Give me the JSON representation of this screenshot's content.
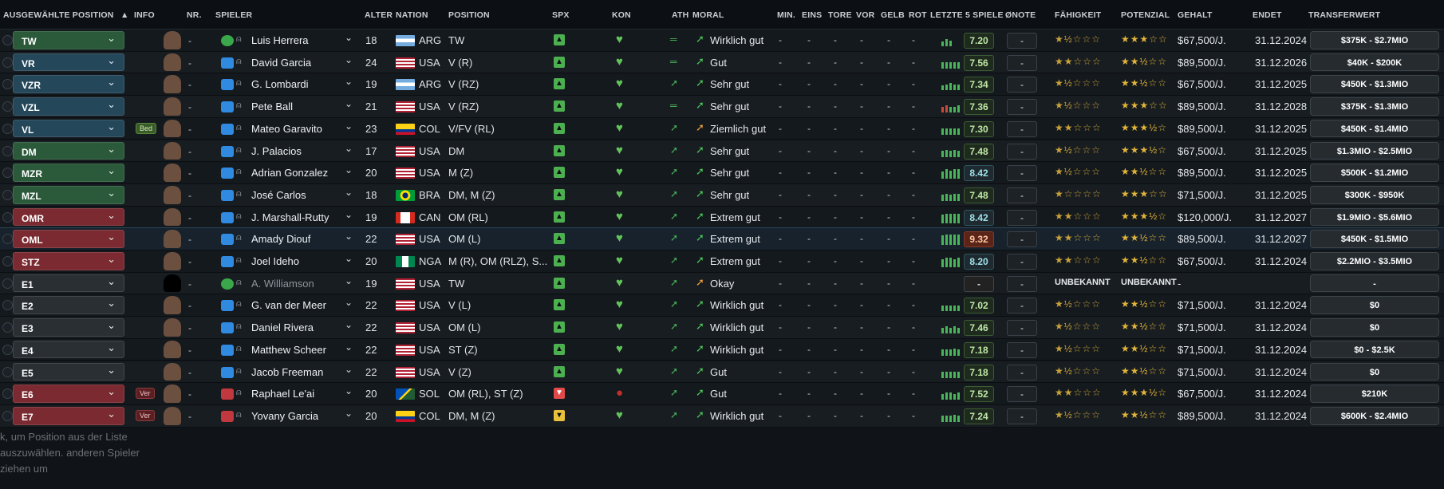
{
  "header": {
    "col_position": "AUSGEWÄHLTE POSITION",
    "col_info": "INFO",
    "col_nr": "NR.",
    "col_spieler": "SPIELER",
    "col_alter": "ALTER",
    "col_nation": "NATION",
    "col_pos": "POSITION",
    "col_spx": "SPX",
    "col_kon": "KON",
    "col_ath": "ATH",
    "col_moral": "MORAL",
    "col_min": "MIN.",
    "col_eins": "EINS",
    "col_tore": "TORE",
    "col_vor": "VOR",
    "col_gelb": "GELB",
    "col_rot": "ROT",
    "col_letzte": "LETZTE 5 SPIELE",
    "col_onote": "ØNOTE",
    "col_faehigkeit": "FÄHIGKEIT",
    "col_potenzial": "POTENZIAL",
    "col_gehalt": "GEHALT",
    "col_endet": "ENDET",
    "col_transfer": "TRANSFERWERT"
  },
  "colors": {
    "green_pos": "#2a5a3a",
    "blue_pos": "#24475a",
    "red_pos": "#7a2a30",
    "neutral_pos": "#2a2f34",
    "accent_green": "#4ab55a"
  },
  "rows": [
    {
      "pos": "TW",
      "pos_color": "g",
      "info": "",
      "nr": "-",
      "name": "Luis Herrera",
      "shirt": "green",
      "alter": "18",
      "nation": "ARG",
      "position": "TW",
      "spx": "g",
      "moral": "Wirklich gut",
      "stats": [
        "-",
        "-",
        "-",
        "-",
        "-",
        "-"
      ],
      "note": "7.20",
      "note_style": "",
      "onote": "-",
      "faeh": "★½☆☆☆",
      "pot": "★★★☆☆",
      "gehalt": "$67,500/J.",
      "endet": "31.12.2024",
      "tw": "$375K - $2.7MIO",
      "bars": [
        4,
        6,
        5
      ],
      "flag": "arg"
    },
    {
      "pos": "VR",
      "pos_color": "b",
      "info": "",
      "nr": "-",
      "name": "David Garcia",
      "shirt": "blue",
      "alter": "24",
      "nation": "USA",
      "position": "V (R)",
      "spx": "g",
      "moral": "Gut",
      "stats": [
        "-",
        "-",
        "-",
        "-",
        "-",
        "-"
      ],
      "note": "7.56",
      "note_style": "",
      "onote": "-",
      "faeh": "★★☆☆☆",
      "pot": "★★½☆☆",
      "gehalt": "$89,500/J.",
      "endet": "31.12.2026",
      "tw": "$40K - $200K",
      "bars": [
        5,
        5,
        5,
        5,
        5
      ],
      "flag": "usa"
    },
    {
      "pos": "VZR",
      "pos_color": "b",
      "info": "",
      "nr": "-",
      "name": "G. Lombardi",
      "shirt": "blue",
      "alter": "19",
      "nation": "ARG",
      "position": "V (RZ)",
      "spx": "g",
      "moral": "Sehr gut",
      "stats": [
        "-",
        "-",
        "-",
        "-",
        "-",
        "-"
      ],
      "note": "7.34",
      "note_style": "",
      "onote": "-",
      "faeh": "★½☆☆☆",
      "pot": "★★½☆☆",
      "gehalt": "$67,500/J.",
      "endet": "31.12.2025",
      "tw": "$450K - $1.3MIO",
      "bars": [
        4,
        5,
        6,
        5,
        5
      ],
      "flag": "arg"
    },
    {
      "pos": "VZL",
      "pos_color": "b",
      "info": "",
      "nr": "-",
      "name": "Pete Ball",
      "shirt": "blue",
      "alter": "21",
      "nation": "USA",
      "position": "V (RZ)",
      "spx": "g",
      "moral": "Sehr gut",
      "stats": [
        "-",
        "-",
        "-",
        "-",
        "-",
        "-"
      ],
      "note": "7.36",
      "note_style": "",
      "onote": "-",
      "faeh": "★½☆☆☆",
      "pot": "★★★☆☆",
      "gehalt": "$89,500/J.",
      "endet": "31.12.2028",
      "tw": "$375K - $1.3MIO",
      "bars": [
        5,
        6,
        5,
        5,
        6
      ],
      "flag": "usa"
    },
    {
      "pos": "VL",
      "pos_color": "b",
      "info": "Bed",
      "nr": "-",
      "name": "Mateo Garavito",
      "shirt": "blue",
      "alter": "23",
      "nation": "COL",
      "position": "V/FV (RL)",
      "spx": "g",
      "moral": "Ziemlich gut",
      "stats": [
        "-",
        "-",
        "-",
        "-",
        "-",
        "-"
      ],
      "note": "7.30",
      "note_style": "",
      "onote": "-",
      "faeh": "★★☆☆☆",
      "pot": "★★★½☆",
      "gehalt": "$89,500/J.",
      "endet": "31.12.2025",
      "tw": "$450K - $1.4MIO",
      "bars": [
        5,
        5,
        5,
        5,
        5
      ],
      "flag": "col"
    },
    {
      "pos": "DM",
      "pos_color": "g",
      "info": "",
      "nr": "-",
      "name": "J. Palacios",
      "shirt": "blue",
      "alter": "17",
      "nation": "USA",
      "position": "DM",
      "spx": "g",
      "moral": "Sehr gut",
      "stats": [
        "-",
        "-",
        "-",
        "-",
        "-",
        "-"
      ],
      "note": "7.48",
      "note_style": "",
      "onote": "-",
      "faeh": "★½☆☆☆",
      "pot": "★★★½☆",
      "gehalt": "$67,500/J.",
      "endet": "31.12.2025",
      "tw": "$1.3MIO - $2.5MIO",
      "bars": [
        5,
        6,
        5,
        6,
        5
      ],
      "flag": "usa"
    },
    {
      "pos": "MZR",
      "pos_color": "g",
      "info": "",
      "nr": "-",
      "name": "Adrian Gonzalez",
      "shirt": "blue",
      "alter": "20",
      "nation": "USA",
      "position": "M (Z)",
      "spx": "g",
      "moral": "Sehr gut",
      "stats": [
        "-",
        "-",
        "-",
        "-",
        "-",
        "-"
      ],
      "note": "8.42",
      "note_style": "t",
      "onote": "-",
      "faeh": "★½☆☆☆",
      "pot": "★★½☆☆",
      "gehalt": "$89,500/J.",
      "endet": "31.12.2025",
      "tw": "$500K - $1.2MIO",
      "bars": [
        6,
        8,
        7,
        8,
        8
      ],
      "flag": "usa"
    },
    {
      "pos": "MZL",
      "pos_color": "g",
      "info": "",
      "nr": "-",
      "name": "José Carlos",
      "shirt": "blue",
      "alter": "18",
      "nation": "BRA",
      "position": "DM, M (Z)",
      "spx": "g",
      "moral": "Sehr gut",
      "stats": [
        "-",
        "-",
        "-",
        "-",
        "-",
        "-"
      ],
      "note": "7.48",
      "note_style": "",
      "onote": "-",
      "faeh": "★☆☆☆☆",
      "pot": "★★★☆☆",
      "gehalt": "$71,500/J.",
      "endet": "31.12.2025",
      "tw": "$300K - $950K",
      "bars": [
        5,
        6,
        5,
        6,
        6
      ],
      "flag": "bra"
    },
    {
      "pos": "OMR",
      "pos_color": "r",
      "info": "",
      "nr": "-",
      "name": "J. Marshall-Rutty",
      "shirt": "blue",
      "alter": "19",
      "nation": "CAN",
      "position": "OM (RL)",
      "spx": "g",
      "moral": "Extrem gut",
      "stats": [
        "-",
        "-",
        "-",
        "-",
        "-",
        "-"
      ],
      "note": "8.42",
      "note_style": "t",
      "onote": "-",
      "faeh": "★★☆☆☆",
      "pot": "★★★½☆",
      "gehalt": "$120,000/J.",
      "endet": "31.12.2027",
      "tw": "$1.9MIO - $5.6MIO",
      "bars": [
        7,
        8,
        8,
        8,
        8
      ],
      "flag": "can"
    },
    {
      "pos": "OML",
      "pos_color": "r",
      "info": "",
      "nr": "-",
      "name": "Amady Diouf",
      "shirt": "blue",
      "alter": "22",
      "nation": "USA",
      "position": "OM (L)",
      "spx": "g",
      "moral": "Extrem gut",
      "stats": [
        "-",
        "-",
        "-",
        "-",
        "-",
        "-"
      ],
      "note": "9.32",
      "note_style": "hi",
      "onote": "-",
      "faeh": "★★☆☆☆",
      "pot": "★★½☆☆",
      "gehalt": "$89,500/J.",
      "endet": "31.12.2027",
      "tw": "$450K - $1.5MIO",
      "bars": [
        8,
        9,
        9,
        9,
        9
      ],
      "flag": "usa",
      "selected": true
    },
    {
      "pos": "STZ",
      "pos_color": "r",
      "info": "",
      "nr": "-",
      "name": "Joel Ideho",
      "shirt": "blue",
      "alter": "20",
      "nation": "NGA",
      "position": "M (R), OM (RLZ), S...",
      "spx": "g",
      "moral": "Extrem gut",
      "stats": [
        "-",
        "-",
        "-",
        "-",
        "-",
        "-"
      ],
      "note": "8.20",
      "note_style": "t",
      "onote": "-",
      "faeh": "★★☆☆☆",
      "pot": "★★½☆☆",
      "gehalt": "$67,500/J.",
      "endet": "31.12.2024",
      "tw": "$2.2MIO - $3.5MIO",
      "bars": [
        7,
        8,
        8,
        7,
        8
      ],
      "flag": "nga"
    },
    {
      "pos": "E1",
      "pos_color": "n",
      "info": "",
      "nr": "-",
      "name": "A. Williamson",
      "shirt": "green",
      "dim": true,
      "alter": "19",
      "nation": "USA",
      "position": "TW",
      "spx": "g",
      "moral": "Okay",
      "stats": [
        "-",
        "-",
        "-",
        "-",
        "-",
        "-"
      ],
      "note": "-",
      "note_style": "e",
      "onote": "-",
      "faeh": "UNBEKANNT",
      "pot": "UNBEKANNT",
      "gehalt": "-",
      "endet": "",
      "tw": "-",
      "bars": [],
      "flag": "usa",
      "blankface": true
    },
    {
      "pos": "E2",
      "pos_color": "n",
      "info": "",
      "nr": "-",
      "name": "G. van der Meer",
      "shirt": "blue",
      "alter": "22",
      "nation": "USA",
      "position": "V (L)",
      "spx": "g",
      "moral": "Wirklich gut",
      "stats": [
        "-",
        "-",
        "-",
        "-",
        "-",
        "-"
      ],
      "note": "7.02",
      "note_style": "",
      "onote": "-",
      "faeh": "★½☆☆☆",
      "pot": "★★½☆☆",
      "gehalt": "$71,500/J.",
      "endet": "31.12.2024",
      "tw": "$0",
      "bars": [
        5,
        5,
        5,
        5,
        5
      ],
      "flag": "usa"
    },
    {
      "pos": "E3",
      "pos_color": "n",
      "info": "",
      "nr": "-",
      "name": "Daniel Rivera",
      "shirt": "blue",
      "alter": "22",
      "nation": "USA",
      "position": "OM (L)",
      "spx": "g",
      "moral": "Wirklich gut",
      "stats": [
        "-",
        "-",
        "-",
        "-",
        "-",
        "-"
      ],
      "note": "7.46",
      "note_style": "",
      "onote": "-",
      "faeh": "★½☆☆☆",
      "pot": "★★½☆☆",
      "gehalt": "$71,500/J.",
      "endet": "31.12.2024",
      "tw": "$0",
      "bars": [
        5,
        6,
        5,
        6,
        5
      ],
      "flag": "usa"
    },
    {
      "pos": "E4",
      "pos_color": "n",
      "info": "",
      "nr": "-",
      "name": "Matthew Scheer",
      "shirt": "blue",
      "alter": "22",
      "nation": "USA",
      "position": "ST (Z)",
      "spx": "g",
      "moral": "Wirklich gut",
      "stats": [
        "-",
        "-",
        "-",
        "-",
        "-",
        "-"
      ],
      "note": "7.18",
      "note_style": "",
      "onote": "-",
      "faeh": "★½☆☆☆",
      "pot": "★★½☆☆",
      "gehalt": "$71,500/J.",
      "endet": "31.12.2024",
      "tw": "$0 - $2.5K",
      "bars": [
        5,
        5,
        5,
        6,
        5
      ],
      "flag": "usa"
    },
    {
      "pos": "E5",
      "pos_color": "n",
      "info": "",
      "nr": "-",
      "name": "Jacob Freeman",
      "shirt": "blue",
      "alter": "22",
      "nation": "USA",
      "position": "V (Z)",
      "spx": "g",
      "moral": "Gut",
      "stats": [
        "-",
        "-",
        "-",
        "-",
        "-",
        "-"
      ],
      "note": "7.18",
      "note_style": "",
      "onote": "-",
      "faeh": "★½☆☆☆",
      "pot": "★★½☆☆",
      "gehalt": "$71,500/J.",
      "endet": "31.12.2024",
      "tw": "$0",
      "bars": [
        5,
        5,
        5,
        5,
        5
      ],
      "flag": "usa"
    },
    {
      "pos": "E6",
      "pos_color": "r",
      "info": "Ver",
      "nr": "-",
      "name": "Raphael Le'ai",
      "shirt": "red",
      "alter": "20",
      "nation": "SOL",
      "position": "OM (RL), ST (Z)",
      "spx": "r",
      "moral": "Gut",
      "stats": [
        "-",
        "-",
        "-",
        "-",
        "-",
        "-"
      ],
      "note": "7.52",
      "note_style": "",
      "onote": "-",
      "faeh": "★★☆☆☆",
      "pot": "★★★½☆",
      "gehalt": "$67,500/J.",
      "endet": "31.12.2024",
      "tw": "$210K",
      "bars": [
        5,
        6,
        6,
        5,
        6
      ],
      "flag": "sol"
    },
    {
      "pos": "E7",
      "pos_color": "r",
      "info": "Ver",
      "nr": "-",
      "name": "Yovany Garcia",
      "shirt": "red",
      "alter": "20",
      "nation": "COL",
      "position": "DM, M (Z)",
      "spx": "y",
      "moral": "Wirklich gut",
      "stats": [
        "-",
        "-",
        "-",
        "-",
        "-",
        "-"
      ],
      "note": "7.24",
      "note_style": "",
      "onote": "-",
      "faeh": "★½☆☆☆",
      "pot": "★★½☆☆",
      "gehalt": "$89,500/J.",
      "endet": "31.12.2024",
      "tw": "$600K - $2.4MIO",
      "bars": [
        5,
        5,
        5,
        6,
        5
      ],
      "flag": "col"
    }
  ],
  "tooltip": "k, um Position aus der Liste auszuwählen. anderen Spieler ziehen um"
}
